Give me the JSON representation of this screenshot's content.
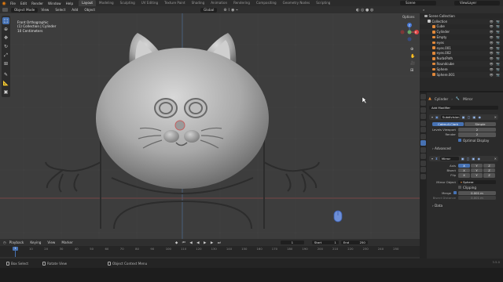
{
  "top_menu": [
    "File",
    "Edit",
    "Render",
    "Window",
    "Help"
  ],
  "workspace_tabs": [
    "Layout",
    "Modeling",
    "Sculpting",
    "UV Editing",
    "Texture Paint",
    "Shading",
    "Animation",
    "Rendering",
    "Compositing",
    "Geometry Nodes",
    "Scripting"
  ],
  "active_workspace": "Layout",
  "scene_name": "Scene",
  "view_layer": "ViewLayer",
  "viewport_header": {
    "mode": "Object Mode",
    "menus": [
      "View",
      "Select",
      "Add",
      "Object"
    ],
    "orientation": "Global",
    "options_label": "Options"
  },
  "viewport_info": {
    "view_name": "Front Orthographic",
    "collection": "(1) Collection | Cylinder",
    "units": "10 Centimeters"
  },
  "gizmo_axes": {
    "x": "X",
    "y": "Y",
    "z": "Z"
  },
  "outliner": {
    "title": "Scene Collection",
    "items": [
      {
        "name": "Collection",
        "color": "#c8c8c8"
      },
      {
        "name": "Cube",
        "color": "#e0883a"
      },
      {
        "name": "Cylinder",
        "color": "#e0883a"
      },
      {
        "name": "Empty",
        "color": "#e0883a"
      },
      {
        "name": "eyes",
        "color": "#e0883a"
      },
      {
        "name": "eyes.001",
        "color": "#e0883a"
      },
      {
        "name": "eyes.002",
        "color": "#e0883a"
      },
      {
        "name": "NurbsPath",
        "color": "#e0883a"
      },
      {
        "name": "Roundcube",
        "color": "#e0883a"
      },
      {
        "name": "Sphere",
        "color": "#e0883a"
      },
      {
        "name": "Sphere.001",
        "color": "#e0883a"
      }
    ]
  },
  "properties": {
    "object_name": "Cylinder",
    "modifier_tab": "Mirror",
    "add_modifier": "Add Modifier",
    "subdivision": {
      "name": "Subdivision",
      "tabs": [
        "Catmull-Clark",
        "Simple"
      ],
      "levels_viewport_label": "Levels Viewport",
      "levels_viewport": "2",
      "render_label": "Render",
      "render": "2",
      "optimal_display": "Optimal Display",
      "advanced": "Advanced"
    },
    "mirror": {
      "name": "Mirror",
      "axis_label": "Axis",
      "bisect_label": "Bisect",
      "flip_label": "Flip",
      "axes": [
        "X",
        "Y",
        "Z"
      ],
      "mirror_object_label": "Mirror Object",
      "mirror_object": "Sphere",
      "clipping": "Clipping",
      "merge_label": "Merge",
      "merge_value": "0.001 m",
      "bisect_distance_label": "Bisect Distance",
      "bisect_distance": "0.001 m",
      "data": "Data"
    }
  },
  "timeline": {
    "menus": [
      "Playback",
      "Keying",
      "View",
      "Marker"
    ],
    "current_frame": "1",
    "start_label": "Start",
    "start": "1",
    "end_label": "End",
    "end": "250",
    "ticks": [
      "10",
      "20",
      "30",
      "40",
      "50",
      "60",
      "70",
      "80",
      "90",
      "100",
      "110",
      "120",
      "130",
      "140",
      "150",
      "160",
      "170",
      "180",
      "190",
      "200",
      "210",
      "220",
      "230",
      "240",
      "250"
    ]
  },
  "status": {
    "select": "Box Select",
    "rotate": "Rotate View",
    "context": "Object Context Menu",
    "version": "3.5.0"
  }
}
